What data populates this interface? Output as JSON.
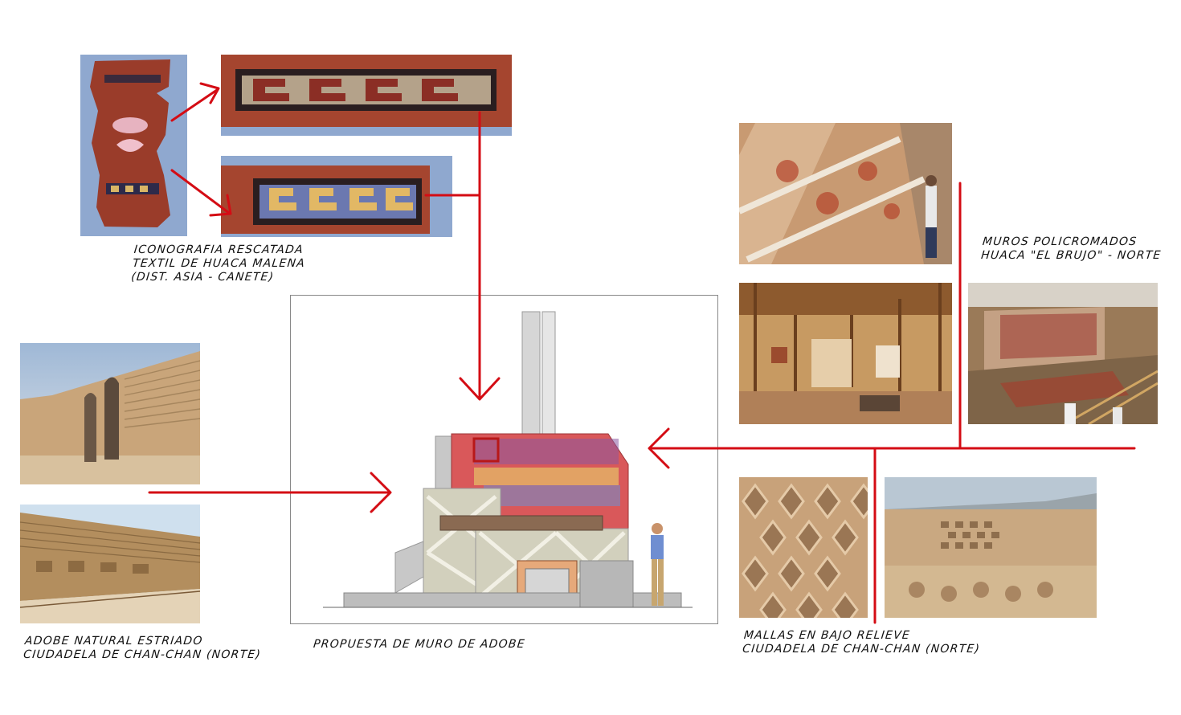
{
  "captions": {
    "textile": [
      "ICONOGRAFIA RESCATADA",
      "TEXTIL DE HUACA MALENA",
      "(DIST. ASIA - CANETE)"
    ],
    "policromados": [
      "MUROS POLICROMADOS",
      "HUACA \"EL BRUJO\" - NORTE"
    ],
    "adobe_natural": [
      "ADOBE NATURAL ESTRIADO",
      "CIUDADELA DE CHAN-CHAN (NORTE)"
    ],
    "propuesta": [
      "PROPUESTA DE MURO DE ADOBE"
    ],
    "mallas": [
      "MALLAS EN BAJO RELIEVE",
      "CIUDADELA DE CHAN-CHAN (NORTE)"
    ]
  },
  "colors": {
    "arrow": "#d40c14",
    "adobe": "#c9a97a",
    "textile_red": "#9c3d2b",
    "wall_red": "#d9585a",
    "sky": "#a9c4e0"
  },
  "icons": [
    "arrow-down-icon",
    "arrow-right-icon",
    "arrow-left-icon"
  ]
}
